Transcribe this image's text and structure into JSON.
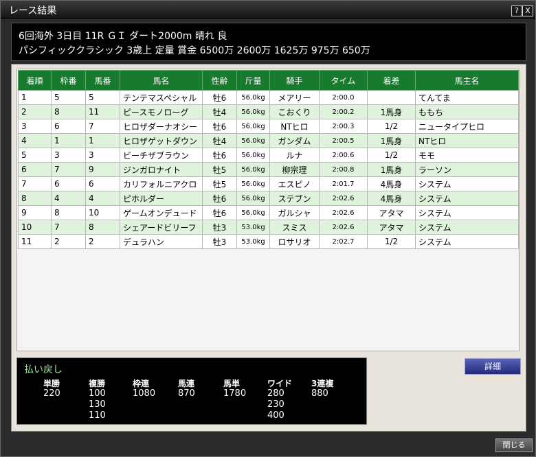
{
  "window": {
    "title": "レース結果"
  },
  "race": {
    "line1": "6回海外 3日目 11R ＧＩ ダート2000m 晴れ 良",
    "line2": "パシフィッククラシック 3歳上 定量 賞金 6500万 2600万 1625万 975万 650万"
  },
  "table": {
    "headers": [
      "着順",
      "枠番",
      "馬番",
      "馬名",
      "性齢",
      "斤量",
      "騎手",
      "タイム",
      "着差",
      "馬主名"
    ],
    "rows": [
      [
        "1",
        "5",
        "5",
        "テンテマスペシャル",
        "牡6",
        "56.0kg",
        "メアリー",
        "2:00.0",
        "",
        "てんてま"
      ],
      [
        "2",
        "8",
        "11",
        "ピースモノローグ",
        "牡4",
        "56.0kg",
        "こおくり",
        "2:00.2",
        "1馬身",
        "ももち"
      ],
      [
        "3",
        "6",
        "7",
        "ヒロザダーナオシー",
        "牡6",
        "56.0kg",
        "NTヒロ",
        "2:00.3",
        "1/2",
        "ニュータイプヒロ"
      ],
      [
        "4",
        "1",
        "1",
        "ヒロザゲットダウン",
        "牡4",
        "56.0kg",
        "ガンダム",
        "2:00.5",
        "1馬身",
        "NTヒロ"
      ],
      [
        "5",
        "3",
        "3",
        "ビーチザブラウン",
        "牡6",
        "56.0kg",
        "ルナ",
        "2:00.6",
        "1/2",
        "モモ"
      ],
      [
        "6",
        "7",
        "9",
        "ジンガロナイト",
        "牡5",
        "56.0kg",
        "柳宗理",
        "2:00.8",
        "1馬身",
        "ラーソン"
      ],
      [
        "7",
        "6",
        "6",
        "カリフォルニアクロ",
        "牡5",
        "56.0kg",
        "エスピノ",
        "2:01.7",
        "4馬身",
        "システム"
      ],
      [
        "8",
        "4",
        "4",
        "ピホルダー",
        "牡6",
        "56.0kg",
        "ステブン",
        "2:02.6",
        "4馬身",
        "システム"
      ],
      [
        "9",
        "8",
        "10",
        "ゲームオンデュード",
        "牡6",
        "56.0kg",
        "ガルシャ",
        "2:02.6",
        "アタマ",
        "システム"
      ],
      [
        "10",
        "7",
        "8",
        "シェアードビリーフ",
        "牡3",
        "53.0kg",
        "スミス",
        "2:02.6",
        "アタマ",
        "システム"
      ],
      [
        "11",
        "2",
        "2",
        "デュラハン",
        "牡3",
        "53.0kg",
        "ロサリオ",
        "2:02.7",
        "1/2",
        "システム"
      ]
    ]
  },
  "payout": {
    "title": "払い戻し",
    "columns": [
      {
        "head": "単勝",
        "values": [
          "220"
        ]
      },
      {
        "head": "複勝",
        "values": [
          "100",
          "130",
          "110"
        ]
      },
      {
        "head": "枠連",
        "values": [
          "1080"
        ]
      },
      {
        "head": "馬連",
        "values": [
          "870"
        ]
      },
      {
        "head": "馬単",
        "values": [
          "1780"
        ]
      },
      {
        "head": "ワイド",
        "values": [
          "280",
          "230",
          "400"
        ]
      },
      {
        "head": "3連複",
        "values": [
          "880"
        ]
      }
    ]
  },
  "buttons": {
    "detail": "詳細",
    "close": "閉じる",
    "help": "?",
    "close_x": "X"
  }
}
